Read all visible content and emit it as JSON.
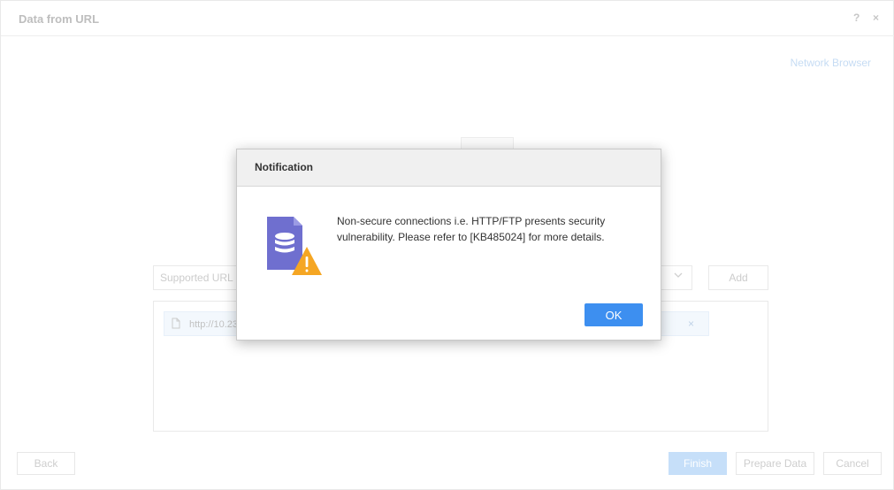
{
  "dialog": {
    "title": "Data from URL",
    "help_icon": "?",
    "close_icon": "×",
    "network_browser_link": "Network Browser",
    "url_input_placeholder": "Supported URL I",
    "add_label": "Add",
    "url_items": [
      {
        "text": "http://10.23"
      }
    ],
    "remove_icon": "×",
    "footer": {
      "back_label": "Back",
      "finish_label": "Finish",
      "prepare_data_label": "Prepare Data",
      "cancel_label": "Cancel"
    }
  },
  "notification": {
    "title": "Notification",
    "message": "Non-secure connections i.e. HTTP/FTP presents security vulnerability. Please refer to [KB485024] for more details.",
    "ok_label": "OK",
    "icon": "database-warning-icon",
    "colors": {
      "doc_icon": "#6f6fcf",
      "warning": "#f5a623",
      "ok_button": "#3d8ff0"
    }
  }
}
